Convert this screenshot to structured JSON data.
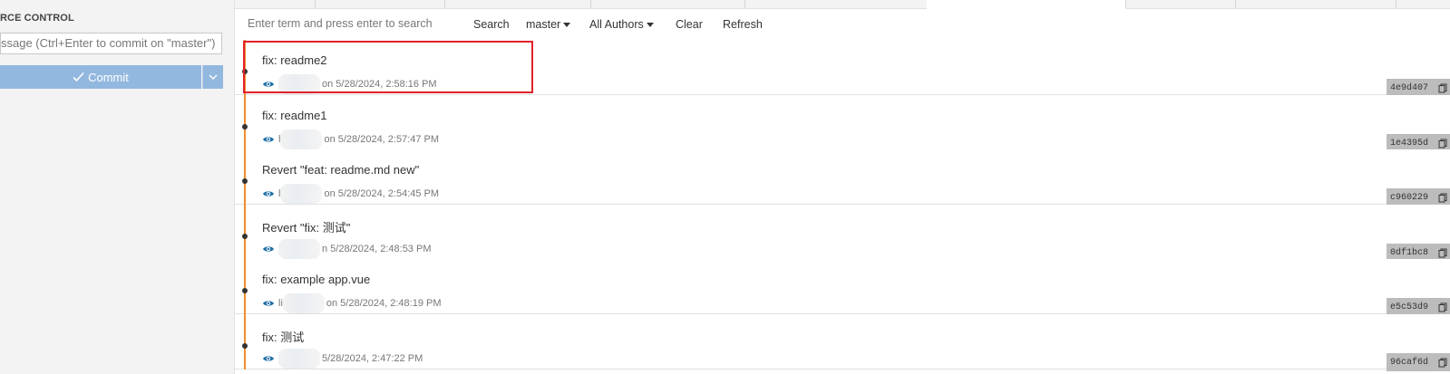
{
  "sidebar": {
    "title": "RCE CONTROL",
    "commit_input_text": "ssage (Ctrl+Enter to commit on \"master\")",
    "commit_button": "Commit"
  },
  "toolbar": {
    "search_placeholder": "Enter term and press enter to search",
    "search_label": "Search",
    "branch": "master",
    "authors": "All Authors",
    "clear": "Clear",
    "refresh": "Refresh"
  },
  "commits": [
    {
      "message": "fix: readme2",
      "author_visible": "",
      "date": "on 5/28/2024, 2:58:16 PM",
      "hash": "4e9d407",
      "highlighted": true
    },
    {
      "message": "fix: readme1",
      "author_visible": "l",
      "date": "on 5/28/2024, 2:57:47 PM",
      "hash": "1e4395d"
    },
    {
      "message": "Revert \"feat: readme.md new\"",
      "author_visible": "l",
      "date": "on 5/28/2024, 2:54:45 PM",
      "hash": "c960229"
    },
    {
      "message": "Revert \"fix: 测试\"",
      "author_visible": "",
      "date": "n 5/28/2024, 2:48:53 PM",
      "hash": "0df1bc8"
    },
    {
      "message": "fix: example app.vue",
      "author_visible": "li",
      "date": "on 5/28/2024, 2:48:19 PM",
      "hash": "e5c53d9"
    },
    {
      "message": "fix: 测试",
      "author_visible": "",
      "date": "5/28/2024, 2:47:22 PM",
      "hash": "96caf6d"
    }
  ],
  "colors": {
    "rail": "#f08d2c",
    "commit_button": "#93b8df",
    "hash_badge": "#bcbcbc",
    "highlight": "#e0222a",
    "eye_icon": "#1d6fa5"
  }
}
